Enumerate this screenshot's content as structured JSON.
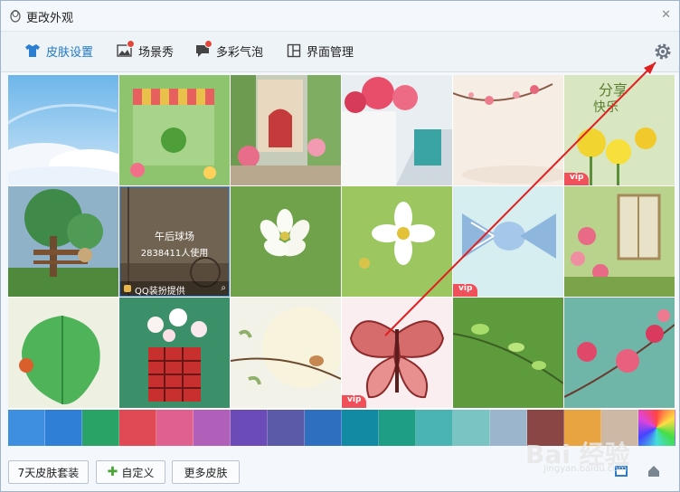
{
  "window": {
    "title": "更改外观"
  },
  "tabs": [
    {
      "label": "皮肤设置",
      "icon": "tshirt-icon",
      "active": true
    },
    {
      "label": "场景秀",
      "icon": "picture-icon",
      "badge": true
    },
    {
      "label": "多彩气泡",
      "icon": "chat-bubble-icon",
      "badge": true
    },
    {
      "label": "界面管理",
      "icon": "layout-icon"
    }
  ],
  "skins": [
    {
      "name": "sky-clouds",
      "vip": ""
    },
    {
      "name": "cafe-house",
      "vip": ""
    },
    {
      "name": "flower-alley",
      "vip": ""
    },
    {
      "name": "white-stairs",
      "vip": ""
    },
    {
      "name": "blossom-branch",
      "vip": ""
    },
    {
      "name": "yellow-flowers",
      "vip": "vip",
      "text": "懂得分享快乐才会加倍"
    },
    {
      "name": "tree-bench",
      "vip": ""
    },
    {
      "name": "afternoon-court",
      "vip": ""
    },
    {
      "name": "white-blossom",
      "vip": ""
    },
    {
      "name": "cosmos-flower",
      "vip": ""
    },
    {
      "name": "candy-wrap",
      "vip": "vip"
    },
    {
      "name": "window-roses",
      "vip": ""
    },
    {
      "name": "green-leaf",
      "vip": ""
    },
    {
      "name": "flower-cup",
      "vip": ""
    },
    {
      "name": "bird-branch",
      "vip": ""
    },
    {
      "name": "butterfly",
      "vip": "vip"
    },
    {
      "name": "green-buds",
      "vip": ""
    },
    {
      "name": "pink-blossom",
      "vip": ""
    }
  ],
  "hover_skin": {
    "title": "午后球场",
    "users": "2838411人使用",
    "provider": "QQ装扮提供"
  },
  "colors": [
    "#3f8fe0",
    "#2f7fd6",
    "#2aa466",
    "#e04a55",
    "#e06090",
    "#b060b8",
    "#6a4bb8",
    "#5a5aa8",
    "#2f6fc0",
    "#138aa3",
    "#1f9e86",
    "#4ab3b3",
    "#7ac4c4",
    "#9ab5cc",
    "#8a4545",
    "#e8a440",
    "#cdb8a6",
    "rainbow"
  ],
  "buttons": {
    "suit": "7天皮肤套装",
    "custom": "自定义",
    "more": "更多皮肤"
  },
  "watermark": {
    "main": "Bai 经验",
    "sub": "jingyan.baidu.com"
  }
}
